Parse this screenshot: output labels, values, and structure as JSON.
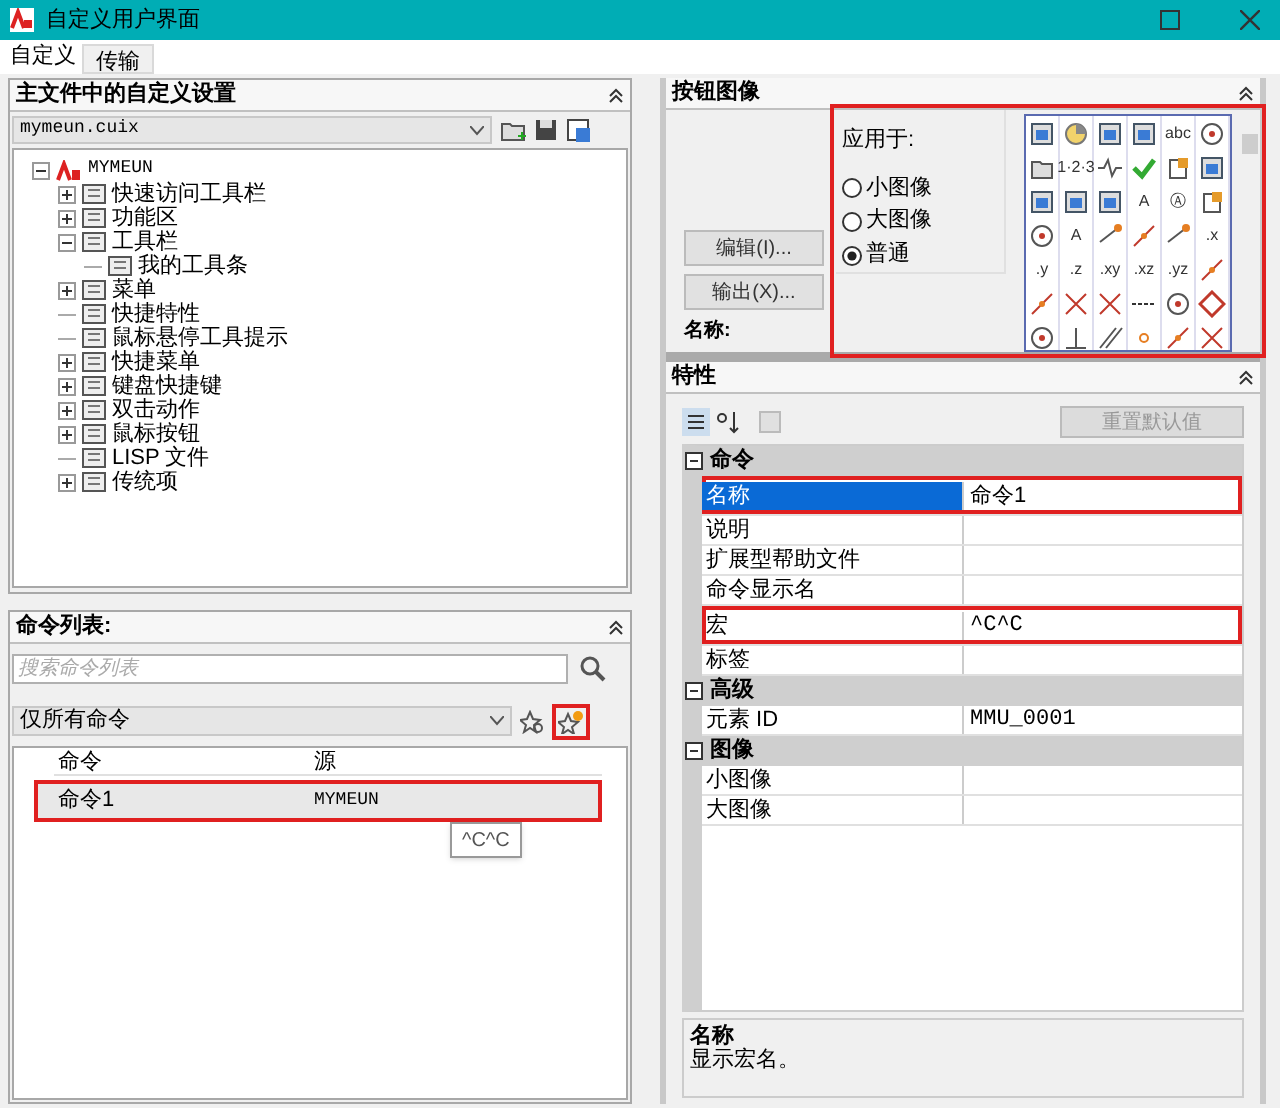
{
  "window": {
    "title": "自定义用户界面"
  },
  "tabs": [
    {
      "label": "自定义",
      "selected": true
    },
    {
      "label": "传输",
      "selected": false
    }
  ],
  "customizations": {
    "header": "主文件中的自定义设置",
    "file": "mymeun.cuix",
    "tree": [
      {
        "label": "MYMEUN",
        "kind": "branch",
        "expanded": true,
        "children": [
          {
            "label": "快速访问工具栏",
            "kind": "branch",
            "expanded": false
          },
          {
            "label": "功能区",
            "kind": "branch",
            "expanded": false
          },
          {
            "label": "工具栏",
            "kind": "branch",
            "expanded": true,
            "children": [
              {
                "label": "我的工具条",
                "kind": "leaf"
              }
            ]
          },
          {
            "label": "菜单",
            "kind": "branch",
            "expanded": false
          },
          {
            "label": "快捷特性",
            "kind": "leaf"
          },
          {
            "label": "鼠标悬停工具提示",
            "kind": "leaf"
          },
          {
            "label": "快捷菜单",
            "kind": "branch",
            "expanded": false
          },
          {
            "label": "键盘快捷键",
            "kind": "branch",
            "expanded": false
          },
          {
            "label": "双击动作",
            "kind": "branch",
            "expanded": false
          },
          {
            "label": "鼠标按钮",
            "kind": "branch",
            "expanded": false
          },
          {
            "label": "LISP 文件",
            "kind": "leaf"
          },
          {
            "label": "传统项",
            "kind": "branch",
            "expanded": false
          }
        ]
      }
    ]
  },
  "command_list": {
    "header": "命令列表:",
    "search": {
      "placeholder": "搜索命令列表"
    },
    "filter": "仅所有命令",
    "columns": [
      "命令",
      "源"
    ],
    "new_favorite_button": {
      "highlighted": true
    },
    "rows": [
      {
        "command": "命令1",
        "source": "MYMEUN",
        "selected": true,
        "highlighted": true
      }
    ],
    "tooltip": "^C^C"
  },
  "button_image": {
    "header": "按钮图像",
    "highlighted": true,
    "buttons": [
      "编辑(I)...",
      "输出(X)..."
    ],
    "name_label": "名称:",
    "apply_to": "应用于:",
    "options": [
      {
        "label": "小图像",
        "selected": false
      },
      {
        "label": "大图像",
        "selected": false
      },
      {
        "label": "普通",
        "selected": true
      }
    ],
    "icons": [
      {
        "kind": "tile"
      },
      {
        "kind": "pie"
      },
      {
        "kind": "tile"
      },
      {
        "kind": "tile"
      },
      {
        "kind": "text",
        "text": "abc"
      },
      {
        "kind": "ring"
      },
      {
        "kind": "folder"
      },
      {
        "kind": "text",
        "text": "1·2·3"
      },
      {
        "kind": "wave"
      },
      {
        "kind": "check"
      },
      {
        "kind": "doc"
      },
      {
        "kind": "tile"
      },
      {
        "kind": "tile"
      },
      {
        "kind": "tile"
      },
      {
        "kind": "tile"
      },
      {
        "kind": "text",
        "text": "A"
      },
      {
        "kind": "text",
        "text": "Ⓐ"
      },
      {
        "kind": "doc"
      },
      {
        "kind": "ring"
      },
      {
        "kind": "text",
        "text": "A"
      },
      {
        "kind": "node"
      },
      {
        "kind": "line"
      },
      {
        "kind": "node"
      },
      {
        "kind": "text",
        "text": ".x"
      },
      {
        "kind": "text",
        "text": ".y"
      },
      {
        "kind": "text",
        "text": ".z"
      },
      {
        "kind": "text",
        "text": ".xy"
      },
      {
        "kind": "text",
        "text": ".xz"
      },
      {
        "kind": "text",
        "text": ".yz"
      },
      {
        "kind": "line"
      },
      {
        "kind": "line"
      },
      {
        "kind": "cross"
      },
      {
        "kind": "cross"
      },
      {
        "kind": "dash"
      },
      {
        "kind": "ring"
      },
      {
        "kind": "diamond"
      },
      {
        "kind": "ring"
      },
      {
        "kind": "perp"
      },
      {
        "kind": "parallel"
      },
      {
        "kind": "dot"
      },
      {
        "kind": "line"
      },
      {
        "kind": "cross"
      }
    ]
  },
  "properties": {
    "header": "特性",
    "reset_button": {
      "label": "重置默认值",
      "disabled": true
    },
    "categories": [
      {
        "label": "命令",
        "rows": [
          {
            "name": "名称",
            "value": "命令1",
            "selected": true,
            "highlighted": true
          },
          {
            "name": "说明",
            "value": "",
            "selected": false,
            "highlighted": false
          },
          {
            "name": "扩展型帮助文件",
            "value": "",
            "selected": false,
            "highlighted": false
          },
          {
            "name": "命令显示名",
            "value": "",
            "selected": false,
            "highlighted": false
          },
          {
            "name": "宏",
            "value": "^C^C",
            "selected": false,
            "highlighted": true
          },
          {
            "name": "标签",
            "value": "",
            "selected": false,
            "highlighted": false
          }
        ]
      },
      {
        "label": "高级",
        "rows": [
          {
            "name": "元素 ID",
            "value": "MMU_0001",
            "selected": false,
            "highlighted": false
          }
        ]
      },
      {
        "label": "图像",
        "rows": [
          {
            "name": "小图像",
            "value": "",
            "selected": false,
            "highlighted": false
          },
          {
            "name": "大图像",
            "value": "",
            "selected": false,
            "highlighted": false
          }
        ]
      }
    ],
    "description": {
      "title": "名称",
      "text": "显示宏名。"
    }
  }
}
